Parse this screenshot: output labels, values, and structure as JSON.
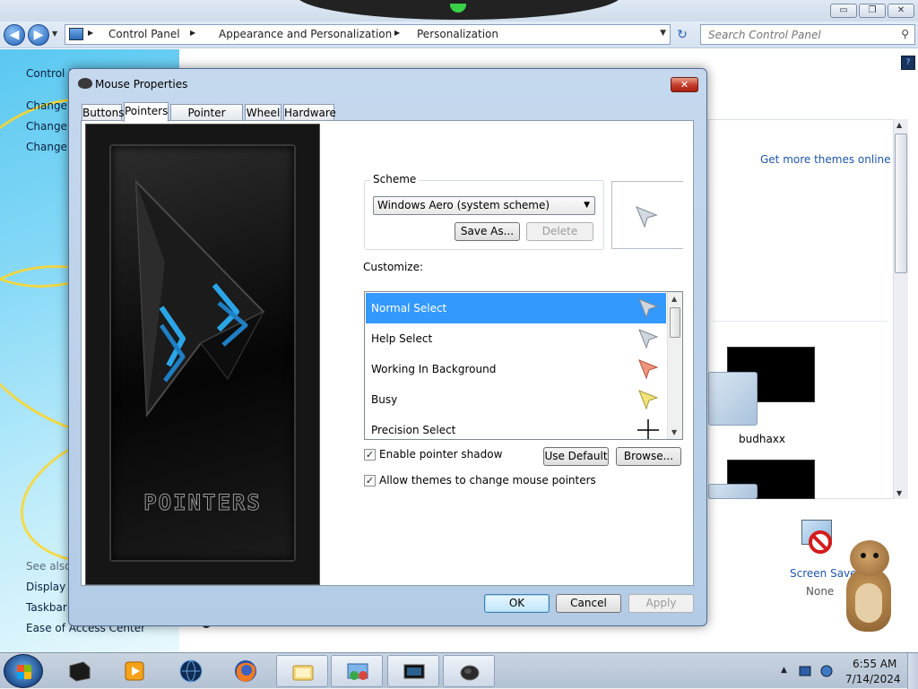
{
  "explorer": {
    "window_controls": {
      "minimize": "▭",
      "maximize": "❐",
      "close": "✕"
    },
    "nav": {
      "back_icon": "◀",
      "forward_icon": "▶",
      "history_dropdown": "▼"
    },
    "breadcrumb": [
      "Control Panel",
      "Appearance and Personalization",
      "Personalization"
    ],
    "breadcrumb_separator": "▶",
    "address_dropdown": "▼",
    "refresh_icon": "↻",
    "search": {
      "placeholder": "Search Control Panel",
      "icon": "search-icon",
      "glyph": "⚲"
    },
    "left_pane": {
      "links": [
        "Control P",
        "Change d",
        "Change ",
        "Change y"
      ],
      "see_also_heading": "See also",
      "see_also_links": [
        "Display",
        "Taskbar a",
        "Ease of Access Center"
      ]
    },
    "right_pane": {
      "help_glyph": "?",
      "get_more_themes": "Get more themes online",
      "theme_label": "budhaxx",
      "screen_saver_label": "Screen Saver",
      "screen_saver_value": "None"
    }
  },
  "dialog": {
    "title": "Mouse Properties",
    "close_glyph": "✕",
    "tabs": [
      "Buttons",
      "Pointers",
      "Pointer Options",
      "Wheel",
      "Hardware"
    ],
    "active_tab": "Pointers",
    "preview_caption": "POINTERS",
    "scheme": {
      "legend": "Scheme",
      "selected": "Windows Aero (system scheme)",
      "dropdown_glyph": "▼",
      "save_as": "Save As...",
      "delete": "Delete"
    },
    "customize_label": "Customize:",
    "cursor_list": [
      {
        "label": "Normal Select",
        "cursor": "normal-select-cursor-icon",
        "color": "#cfd6de",
        "selected": true
      },
      {
        "label": "Help Select",
        "cursor": "help-select-cursor-icon",
        "color": "#cfd6de",
        "selected": false
      },
      {
        "label": "Working In Background",
        "cursor": "working-cursor-icon",
        "color": "#f0957d",
        "selected": false
      },
      {
        "label": "Busy",
        "cursor": "busy-cursor-icon",
        "color": "#f2e27a",
        "selected": false
      },
      {
        "label": "Precision Select",
        "cursor": "crosshair-cursor-icon",
        "color": "#000000",
        "selected": false
      }
    ],
    "list_scroll": {
      "up": "▲",
      "down": "▼"
    },
    "enable_pointer_shadow": {
      "label": "Enable pointer shadow",
      "checked": true
    },
    "allow_themes": {
      "label": "Allow themes to change mouse pointers",
      "checked": true
    },
    "check_glyph": "✓",
    "use_default": "Use Default",
    "browse": "Browse...",
    "ok": "OK",
    "cancel": "Cancel",
    "apply": "Apply"
  },
  "taskbar": {
    "pinned": [
      {
        "name": "taskbar-app-box",
        "open": false
      },
      {
        "name": "taskbar-media-player",
        "open": false
      },
      {
        "name": "taskbar-globe",
        "open": false
      },
      {
        "name": "taskbar-firefox",
        "open": false
      },
      {
        "name": "taskbar-explorer",
        "open": true
      },
      {
        "name": "taskbar-control-panel",
        "open": true
      },
      {
        "name": "taskbar-monitor",
        "open": true
      },
      {
        "name": "taskbar-mouse",
        "open": true
      }
    ],
    "tray_expand": "▲",
    "clock": {
      "time": "6:55 AM",
      "date": "7/14/2024"
    }
  },
  "colors": {
    "selection": "#3399ff",
    "link": "#1f56a8",
    "accent_blue": "#2d64b0"
  }
}
